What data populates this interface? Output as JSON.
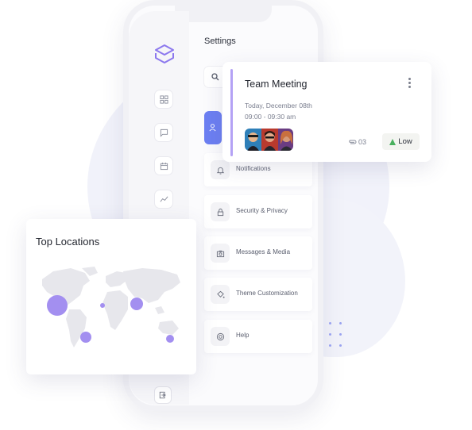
{
  "settings": {
    "title": "Settings",
    "menu": [
      {
        "label": "Notifications",
        "icon": "bell-icon"
      },
      {
        "label": "Security & Privacy",
        "icon": "lock-icon"
      },
      {
        "label": "Messages & Media",
        "icon": "camera-icon"
      },
      {
        "label": "Theme Customization",
        "icon": "paint-bucket-icon"
      },
      {
        "label": "Help",
        "icon": "lifebuoy-icon"
      }
    ]
  },
  "meeting": {
    "title": "Team Meeting",
    "date": "Today, December 08th",
    "time": "09:00 - 09:30 am",
    "attachments": "03",
    "priority": "Low"
  },
  "locations": {
    "title": "Top Locations"
  },
  "colors": {
    "accent": "#6c7ff2",
    "meeting_bar": "#b4a2f5",
    "map_bubble": "#a38ff0",
    "priority_low": "#49b05f"
  }
}
